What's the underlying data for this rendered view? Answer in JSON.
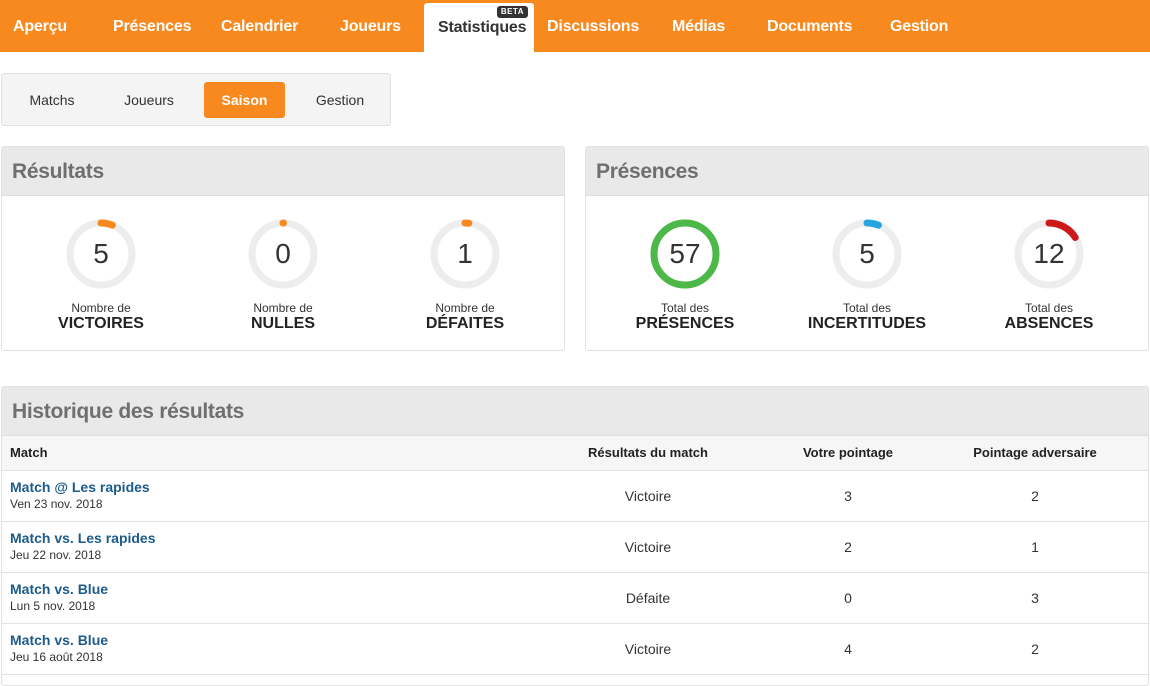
{
  "nav": {
    "tabs": [
      "Aperçu",
      "Présences",
      "Calendrier",
      "Joueurs",
      "Statistiques",
      "Discussions",
      "Médias",
      "Documents",
      "Gestion"
    ],
    "active_badge": "BETA"
  },
  "subtabs": [
    "Matchs",
    "Joueurs",
    "Saison",
    "Gestion"
  ],
  "results": {
    "title": "Résultats",
    "stats": [
      {
        "value": "5",
        "small": "Nombre de",
        "big": "VICTOIRES",
        "color": "#f7891f",
        "fraction": 0.06
      },
      {
        "value": "0",
        "small": "Nombre de",
        "big": "NULLES",
        "color": "#f7891f",
        "fraction": 0.0
      },
      {
        "value": "1",
        "small": "Nombre de",
        "big": "DÉFAITES",
        "color": "#f7891f",
        "fraction": 0.02
      }
    ]
  },
  "presences": {
    "title": "Présences",
    "stats": [
      {
        "value": "57",
        "small": "Total des",
        "big": "PRÉSENCES",
        "color": "#4cb848",
        "fraction": 1.0
      },
      {
        "value": "5",
        "small": "Total des",
        "big": "INCERTITUDES",
        "color": "#26a6e0",
        "fraction": 0.06
      },
      {
        "value": "12",
        "small": "Total des",
        "big": "ABSENCES",
        "color": "#cc1a1a",
        "fraction": 0.16
      }
    ]
  },
  "history": {
    "title": "Historique des résultats",
    "headers": [
      "Match",
      "Résultats du match",
      "Votre pointage",
      "Pointage adversaire"
    ],
    "rows": [
      {
        "match": "Match @ Les rapides",
        "date": "Ven 23 nov. 2018",
        "result": "Victoire",
        "ours": "3",
        "theirs": "2"
      },
      {
        "match": "Match vs. Les rapides",
        "date": "Jeu 22 nov. 2018",
        "result": "Victoire",
        "ours": "2",
        "theirs": "1"
      },
      {
        "match": "Match vs. Blue",
        "date": "Lun 5 nov. 2018",
        "result": "Défaite",
        "ours": "0",
        "theirs": "3"
      },
      {
        "match": "Match vs. Blue",
        "date": "Jeu 16 août 2018",
        "result": "Victoire",
        "ours": "4",
        "theirs": "2"
      }
    ]
  }
}
